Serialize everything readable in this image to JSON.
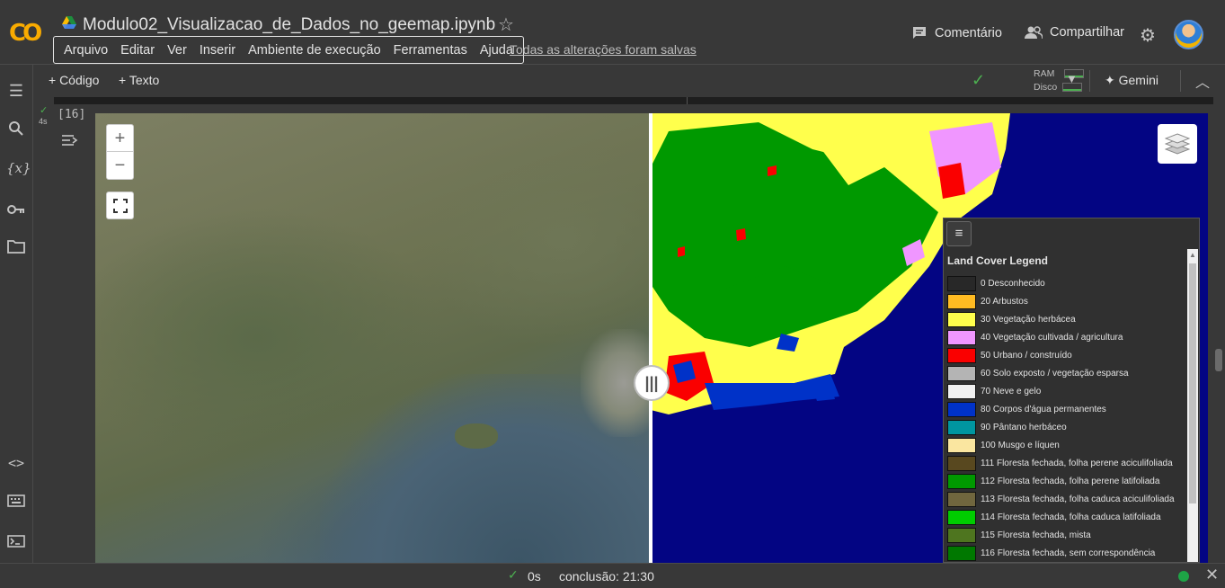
{
  "app": {
    "logo_text": "CO",
    "notebook_title": "Modulo02_Visualizacao_de_Dados_no_geemap.ipynb",
    "saved_status": "Todas as alterações foram salvas"
  },
  "menu": [
    "Arquivo",
    "Editar",
    "Ver",
    "Inserir",
    "Ambiente de execução",
    "Ferramentas",
    "Ajuda"
  ],
  "header_actions": {
    "comment_label": "Comentário",
    "share_label": "Compartilhar"
  },
  "toolbar": {
    "add_code_label": "+ Código",
    "add_text_label": "+ Texto",
    "ram_label": "RAM",
    "disk_label": "Disco",
    "gemini_label": "Gemini"
  },
  "cell": {
    "execution_count": "[16]",
    "run_time": "4s"
  },
  "legend": {
    "title": "Land Cover Legend",
    "items": [
      {
        "label": "0 Desconhecido",
        "color": "#282828"
      },
      {
        "label": "20 Arbustos",
        "color": "#ffbb22"
      },
      {
        "label": "30 Vegetação herbácea",
        "color": "#ffff4c"
      },
      {
        "label": "40 Vegetação cultivada / agricultura",
        "color": "#f096ff"
      },
      {
        "label": "50 Urbano / construído",
        "color": "#fa0000"
      },
      {
        "label": "60 Solo exposto / vegetação esparsa",
        "color": "#b4b4b4"
      },
      {
        "label": "70 Neve e gelo",
        "color": "#f0f0f0"
      },
      {
        "label": "80 Corpos d'água permanentes",
        "color": "#0032c8"
      },
      {
        "label": "90 Pântano herbáceo",
        "color": "#0096a0"
      },
      {
        "label": "100 Musgo e líquen",
        "color": "#fae6a0"
      },
      {
        "label": "111 Floresta fechada, folha perene aciculifoliada",
        "color": "#58481f"
      },
      {
        "label": "112 Floresta fechada, folha perene latifoliada",
        "color": "#009900"
      },
      {
        "label": "113 Floresta fechada, folha caduca aciculifoliada",
        "color": "#70663e"
      },
      {
        "label": "114 Floresta fechada, folha caduca latifoliada",
        "color": "#00cc00"
      },
      {
        "label": "115 Floresta fechada, mista",
        "color": "#4e751f"
      },
      {
        "label": "116 Floresta fechada, sem correspondência",
        "color": "#007800"
      }
    ]
  },
  "status": {
    "elapsed": "0s",
    "completion": "conclusão: 21:30"
  }
}
